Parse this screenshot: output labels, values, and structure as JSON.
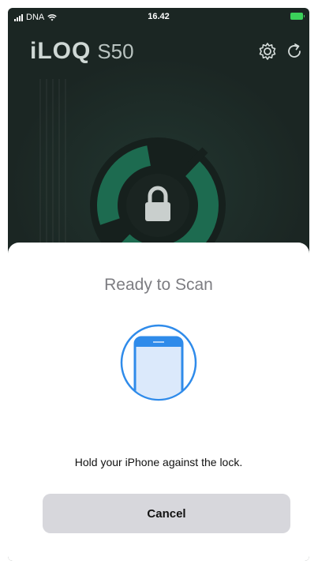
{
  "status_bar": {
    "carrier": "DNA",
    "time": "16.42"
  },
  "header": {
    "brand": "iLOQ",
    "model": "S50",
    "settings_icon": "gear-icon",
    "refresh_icon": "refresh-icon"
  },
  "lock_display": {
    "icon": "padlock-icon",
    "ring_color": "#1d6b50"
  },
  "scan_sheet": {
    "title": "Ready to Scan",
    "icon": "phone-scan-icon",
    "message": "Hold your iPhone against the lock.",
    "cancel_label": "Cancel",
    "accent_color": "#2f8bea"
  }
}
